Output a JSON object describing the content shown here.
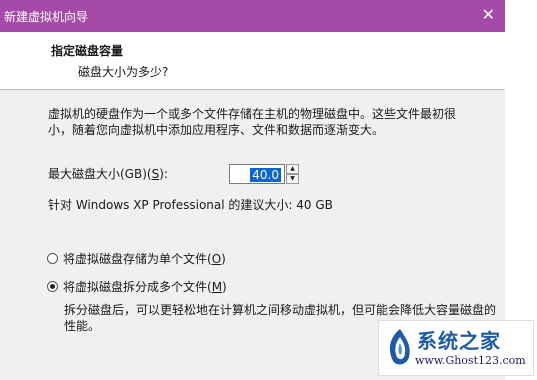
{
  "window": {
    "title": "新建虚拟机向导",
    "close_symbol": "✕"
  },
  "header": {
    "heading": "指定磁盘容量",
    "subheading": "磁盘大小为多少?"
  },
  "description": "虚拟机的硬盘作为一个或多个文件存储在主机的物理磁盘中。这些文件最初很小，随着您向虚拟机中添加应用程序、文件和数据而逐渐变大。",
  "disk_size": {
    "label_prefix": "最大磁盘大小(GB)(",
    "label_key": "S",
    "label_suffix": "):",
    "value": "40.0",
    "spin_up_icon": "▲",
    "spin_down_icon": "▼"
  },
  "recommendation": "针对 Windows XP Professional 的建议大小: 40 GB",
  "options": [
    {
      "prefix": "将虚拟磁盘存储为单个文件(",
      "key": "O",
      "suffix": ")",
      "selected": false
    },
    {
      "prefix": "将虚拟磁盘拆分成多个文件(",
      "key": "M",
      "suffix": ")",
      "selected": true
    }
  ],
  "split_note": "拆分磁盘后，可以更轻松地在计算机之间移动虚拟机，但可能会降低大容量磁盘的性能。",
  "watermark": {
    "brand": "系统之家",
    "url": "www.Ghost123.com"
  },
  "colors": {
    "titlebar": "#a54aa6",
    "selection": "#0a64d6"
  }
}
